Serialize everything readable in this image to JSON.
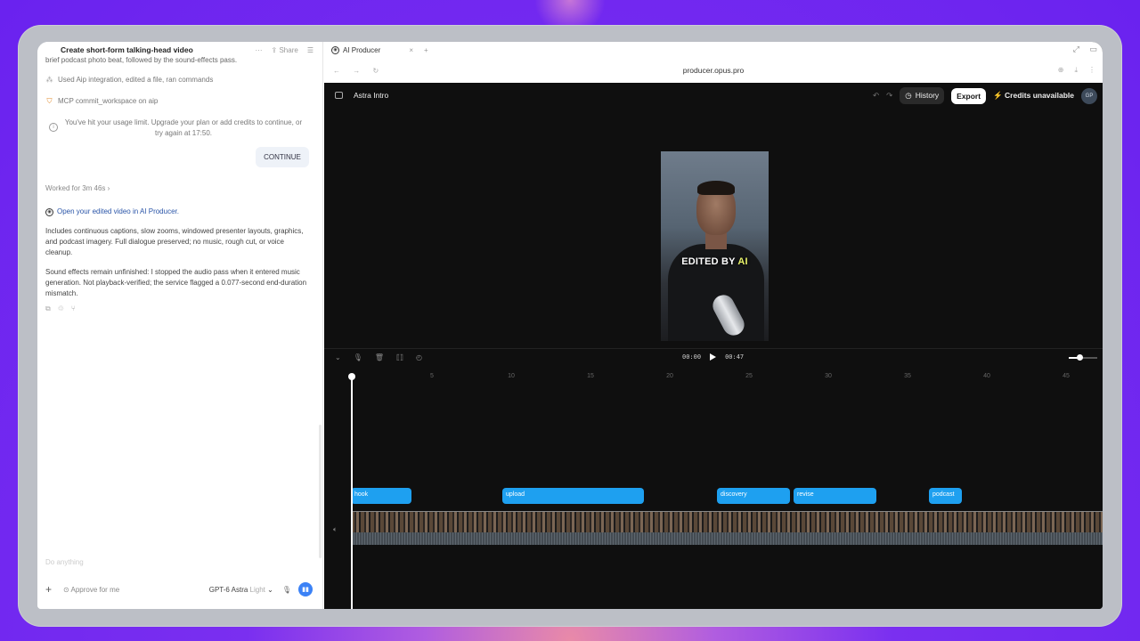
{
  "left_panel": {
    "title": "Create short-form talking-head video",
    "share_label": "Share",
    "chat": {
      "cut_text": "brief podcast photo beat, followed by the sound-effects pass.",
      "tool_row_1": "Used Aip integration, edited a file, ran commands",
      "tool_row_2": "MCP commit_workspace on aip",
      "limit_text": "You've hit your usage limit. Upgrade your plan or add credits to continue, or try again at 17:50.",
      "continue_label": "CONTINUE",
      "worked_label": "Worked for 3m 46s",
      "open_link": "Open your edited video in AI Producer.",
      "para_1": "Includes continuous captions, slow zooms, windowed presenter layouts, graphics, and podcast imagery. Full dialogue preserved; no music, rough cut, or voice cleanup.",
      "para_2": "Sound effects remain unfinished: I stopped the audio pass when it entered music generation. Not playback-verified; the service flagged a 0.077-second end-duration mismatch."
    },
    "composer": {
      "placeholder": "Do anything",
      "approve_label": "Approve for me",
      "model_name": "GPT-6 Astra",
      "model_mode": "Light"
    }
  },
  "browser": {
    "tab_label": "AI Producer",
    "url": "producer.opus.pro"
  },
  "app": {
    "project_title": "Astra Intro",
    "history_label": "History",
    "export_label": "Export",
    "credits_label": "Credits unavailable",
    "avatar_initials": "GP",
    "caption_main": "EDITED BY ",
    "caption_accent": "AI",
    "caption_accent_color": "#e8f26a",
    "time_current": "00:00",
    "time_total": "00:47",
    "ruler_ticks": [
      "5",
      "10",
      "15",
      "20",
      "25",
      "30",
      "35",
      "40",
      "45"
    ],
    "clips": [
      {
        "label": "hook"
      },
      {
        "label": "upload"
      },
      {
        "label": "discovery"
      },
      {
        "label": "revise"
      },
      {
        "label": "podcast"
      }
    ],
    "clip_color": "#1ea0f0"
  }
}
